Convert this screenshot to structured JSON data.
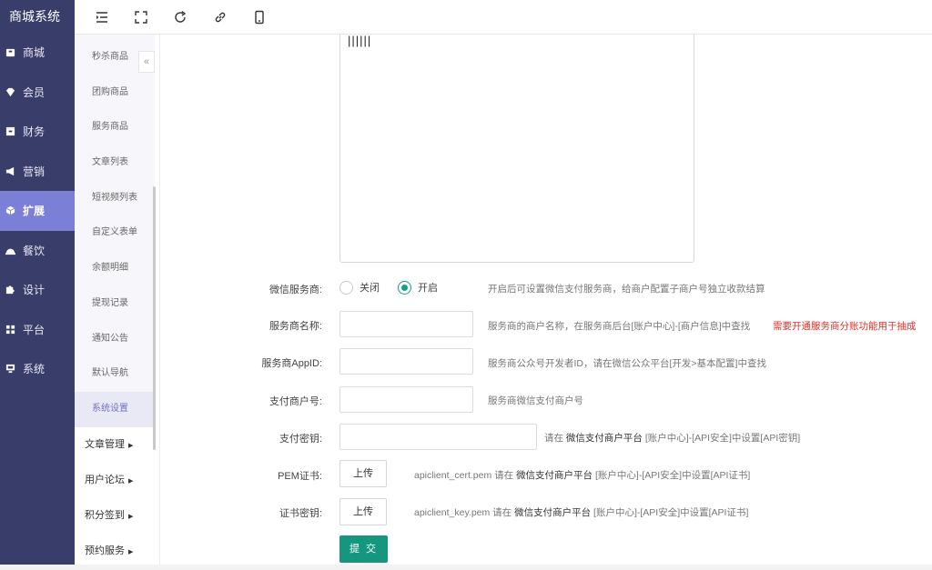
{
  "brand": "商城系统",
  "nav": [
    {
      "label": "商城",
      "icon": "shop-icon"
    },
    {
      "label": "会员",
      "icon": "member-icon"
    },
    {
      "label": "财务",
      "icon": "finance-icon"
    },
    {
      "label": "营销",
      "icon": "megaphone-icon"
    },
    {
      "label": "扩展",
      "icon": "cube-icon"
    },
    {
      "label": "餐饮",
      "icon": "dining-icon"
    },
    {
      "label": "设计",
      "icon": "puzzle-icon"
    },
    {
      "label": "平台",
      "icon": "grid-icon"
    },
    {
      "label": "系统",
      "icon": "monitor-icon"
    }
  ],
  "submenu": {
    "items": [
      "秒杀商品",
      "团购商品",
      "服务商品",
      "文章列表",
      "短视频列表",
      "自定义表单",
      "余额明细",
      "提现记录",
      "通知公告",
      "默认导航",
      "系统设置"
    ],
    "groups": [
      "文章管理",
      "用户论坛",
      "积分签到",
      "预约服务"
    ],
    "collapse": "«"
  },
  "editor": {
    "content": "||||||"
  },
  "form": {
    "wx_provider": {
      "label": "微信服务商:",
      "opt_off": "关闭",
      "opt_on": "开启",
      "selected": "开启",
      "hint": "开启后可设置微信支付服务商，给商户配置子商户号独立收款结算"
    },
    "provider_name": {
      "label": "服务商名称:",
      "value": "",
      "hint": "服务商的商户名称，在服务商后台[账户中心]-[商户信息]中查找",
      "warn": "需要开通服务商分账功能用于抽成"
    },
    "provider_appid": {
      "label": "服务商AppID:",
      "value": "",
      "hint": "服务商公众号开发者ID，请在微信公众平台[开发>基本配置]中查找"
    },
    "merchant_no": {
      "label": "支付商户号:",
      "value": "",
      "hint": "服务商微信支付商户号"
    },
    "pay_key": {
      "label": "支付密钥:",
      "value": "",
      "hint_pre": "请在",
      "hint_bold": "微信支付商户平台",
      "hint_post": "[账户中心]-[API安全]中设置[API密钥]"
    },
    "pem_cert": {
      "label": "PEM证书:",
      "button": "上传",
      "hint_pre": "apiclient_cert.pem 请在",
      "hint_bold": "微信支付商户平台",
      "hint_post": "[账户中心]-[API安全]中设置[API证书]"
    },
    "cert_key": {
      "label": "证书密钥:",
      "button": "上传",
      "hint_pre": "apiclient_key.pem 请在",
      "hint_bold": "微信支付商户平台",
      "hint_post": "[账户中心]-[API安全]中设置[API证书]"
    },
    "submit": "提 交"
  },
  "colors": {
    "sidebar": "#393d6a",
    "sidebar_active": "#7b7fd6",
    "accent": "#16967e",
    "warn": "#e0312a"
  }
}
